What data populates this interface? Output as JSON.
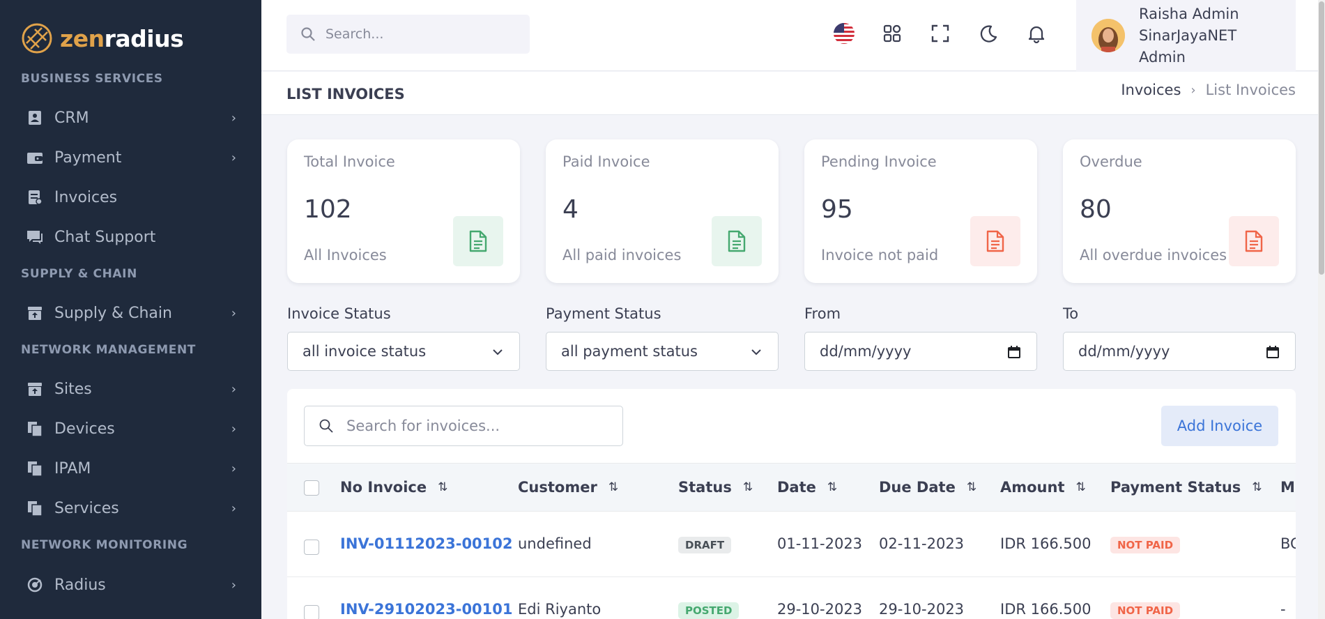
{
  "app": {
    "logo_part1": "zen",
    "logo_part2": "radius",
    "accent": "#e0a24a"
  },
  "sidebar": {
    "sections": [
      {
        "title": "BUSINESS SERVICES"
      },
      {
        "title": "SUPPLY & CHAIN"
      },
      {
        "title": "NETWORK MANAGEMENT"
      },
      {
        "title": "NETWORK MONITORING"
      }
    ],
    "items": [
      {
        "label": "CRM",
        "icon": "contact-card-icon",
        "expandable": true
      },
      {
        "label": "Payment",
        "icon": "wallet-icon",
        "expandable": true
      },
      {
        "label": "Invoices",
        "icon": "invoice-icon",
        "expandable": false
      },
      {
        "label": "Chat Support",
        "icon": "chat-icon",
        "expandable": false
      },
      {
        "label": "Supply & Chain",
        "icon": "archive-icon",
        "expandable": true
      },
      {
        "label": "Sites",
        "icon": "archive-icon",
        "expandable": true
      },
      {
        "label": "Devices",
        "icon": "stack-icon",
        "expandable": true
      },
      {
        "label": "IPAM",
        "icon": "stack-icon",
        "expandable": true
      },
      {
        "label": "Services",
        "icon": "stack-icon",
        "expandable": true
      },
      {
        "label": "Radius",
        "icon": "radar-icon",
        "expandable": true
      }
    ]
  },
  "topbar": {
    "search_placeholder": "Search...",
    "icons": [
      "us-flag-icon",
      "apps-grid-icon",
      "fullscreen-icon",
      "moon-icon",
      "bell-icon"
    ],
    "user": {
      "name": "Raisha Admin",
      "org": "SinarJayaNET",
      "role": "Admin"
    }
  },
  "page": {
    "title": "LIST INVOICES",
    "breadcrumb": [
      "Invoices",
      "List Invoices"
    ]
  },
  "stats": [
    {
      "title": "Total Invoice",
      "value": "102",
      "subtitle": "All Invoices",
      "tone": "green"
    },
    {
      "title": "Paid Invoice",
      "value": "4",
      "subtitle": "All paid invoices",
      "tone": "green"
    },
    {
      "title": "Pending Invoice",
      "value": "95",
      "subtitle": "Invoice not paid",
      "tone": "red"
    },
    {
      "title": "Overdue",
      "value": "80",
      "subtitle": "All overdue invoices",
      "tone": "red"
    }
  ],
  "filters": {
    "invoice_status": {
      "label": "Invoice Status",
      "value": "all invoice status"
    },
    "payment_status": {
      "label": "Payment Status",
      "value": "all payment status"
    },
    "from": {
      "label": "From",
      "placeholder": "dd/mm/yyyy"
    },
    "to": {
      "label": "To",
      "placeholder": "dd/mm/yyyy"
    }
  },
  "table": {
    "search_placeholder": "Search for invoices...",
    "add_button": "Add Invoice",
    "columns": [
      "No Invoice",
      "Customer",
      "Status",
      "Date",
      "Due Date",
      "Amount",
      "Payment Status",
      "M"
    ],
    "rows": [
      {
        "no": "INV-01112023-00102",
        "customer": "undefined",
        "status": "DRAFT",
        "date": "01-11-2023",
        "due": "02-11-2023",
        "amount": "IDR 166.500",
        "payment": "NOT PAID",
        "method": "BC"
      },
      {
        "no": "INV-29102023-00101",
        "customer": "Edi Riyanto",
        "status": "POSTED",
        "date": "29-10-2023",
        "due": "29-10-2023",
        "amount": "IDR 166.500",
        "payment": "NOT PAID",
        "method": "-"
      }
    ]
  },
  "colors": {
    "sidebar_bg": "#1f2a3c",
    "link_blue": "#3b74d8",
    "green": "#45a86f",
    "red": "#f06548"
  }
}
